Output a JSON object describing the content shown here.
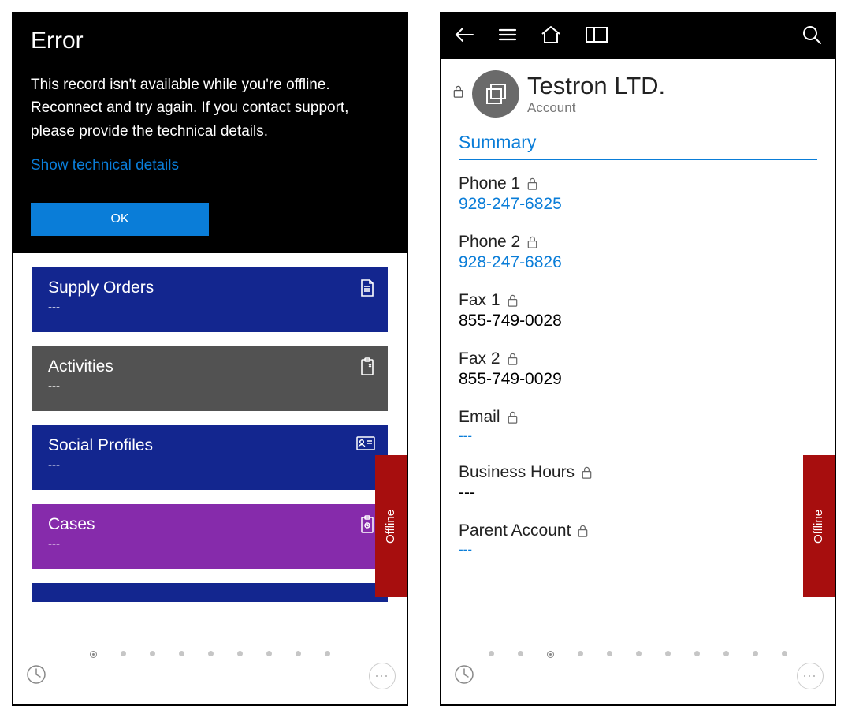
{
  "left": {
    "error": {
      "title": "Error",
      "message": "This record isn't available while you're offline. Reconnect and try again. If you contact support, please provide the technical details.",
      "tech_link": "Show technical details",
      "ok_label": "OK"
    },
    "tiles": [
      {
        "title": "Supply Orders",
        "sub": "---"
      },
      {
        "title": "Activities",
        "sub": "---"
      },
      {
        "title": "Social Profiles",
        "sub": "---"
      },
      {
        "title": "Cases",
        "sub": "---"
      }
    ],
    "offline_label": "Offline",
    "page_dots": {
      "count": 9,
      "active": 0
    }
  },
  "right": {
    "record": {
      "title": "Testron LTD.",
      "subtitle": "Account"
    },
    "section_title": "Summary",
    "fields": [
      {
        "label": "Phone 1",
        "value": "928-247-6825",
        "link": true
      },
      {
        "label": "Phone 2",
        "value": "928-247-6826",
        "link": true
      },
      {
        "label": "Fax 1",
        "value": "855-749-0028",
        "link": false
      },
      {
        "label": "Fax 2",
        "value": "855-749-0029",
        "link": false
      },
      {
        "label": "Email",
        "value": "---",
        "dim": true
      },
      {
        "label": "Business Hours",
        "value": "---",
        "link": false
      },
      {
        "label": "Parent Account",
        "value": "---",
        "dim": true
      }
    ],
    "offline_label": "Offline",
    "page_dots": {
      "count": 11,
      "active": 2
    }
  }
}
